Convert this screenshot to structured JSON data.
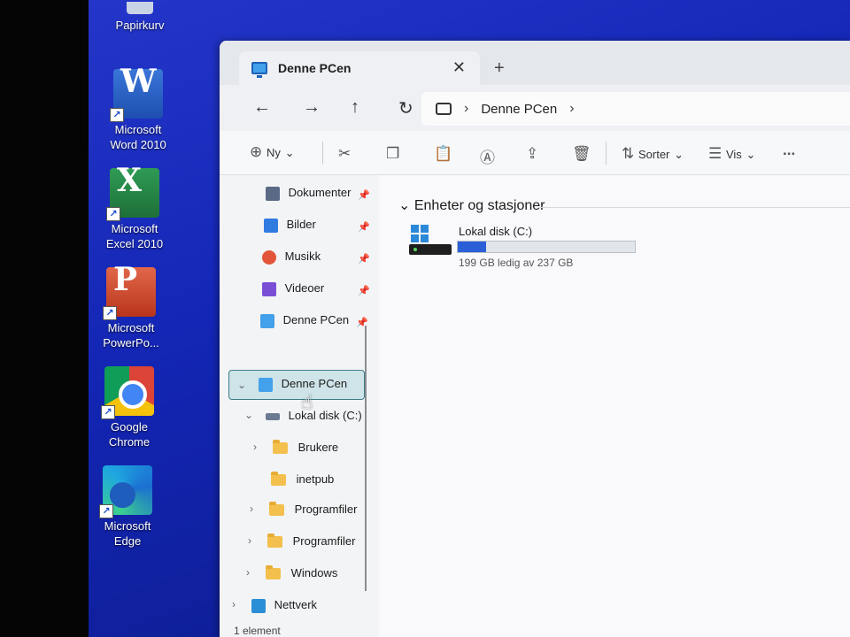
{
  "desktop": {
    "icons": [
      {
        "label": "Papirkurv",
        "icon": "recycle-bin-icon"
      },
      {
        "label": "Microsoft Word 2010",
        "icon": "word-icon",
        "letter": "W"
      },
      {
        "label": "Microsoft Excel 2010",
        "icon": "excel-icon",
        "letter": "X"
      },
      {
        "label": "Microsoft PowerPo...",
        "icon": "powerpoint-icon",
        "letter": "P"
      },
      {
        "label": "Google Chrome",
        "icon": "chrome-icon"
      },
      {
        "label": "Microsoft Edge",
        "icon": "edge-icon"
      }
    ]
  },
  "window": {
    "tab_title": "Denne PCen",
    "tab_close": "✕",
    "new_tab": "+"
  },
  "nav": {
    "back": "←",
    "forward": "→",
    "up": "↑",
    "refresh": "↻",
    "breadcrumb": [
      "Denne PCen"
    ],
    "sep": "›"
  },
  "commands": {
    "new_label": "Ny",
    "sort_label": "Sorter",
    "view_label": "Vis",
    "more": "..."
  },
  "sidebar": {
    "quick_access": [
      {
        "label": "Dokumenter",
        "icon": "documents-icon",
        "color": "#5a6a86"
      },
      {
        "label": "Bilder",
        "icon": "pictures-icon",
        "color": "#2f7be0"
      },
      {
        "label": "Musikk",
        "icon": "music-icon",
        "color": "#e2553a"
      },
      {
        "label": "Videoer",
        "icon": "videos-icon",
        "color": "#7a4fd6"
      },
      {
        "label": "Denne PCen",
        "icon": "pc-icon",
        "color": "#43a0ea"
      }
    ],
    "tree": {
      "this_pc": "Denne PCen",
      "local_disk": "Lokal disk (C:)",
      "folders": [
        "Brukere",
        "inetpub",
        "Programfiler",
        "Programfiler",
        "Windows"
      ],
      "network": "Nettverk"
    }
  },
  "content": {
    "group_header": "Enheter og stasjoner",
    "drive": {
      "name": "Lokal disk (C:)",
      "free_text": "199 GB ledig av 237 GB",
      "used_fraction": 0.16
    }
  },
  "status": {
    "text": "1 element"
  }
}
